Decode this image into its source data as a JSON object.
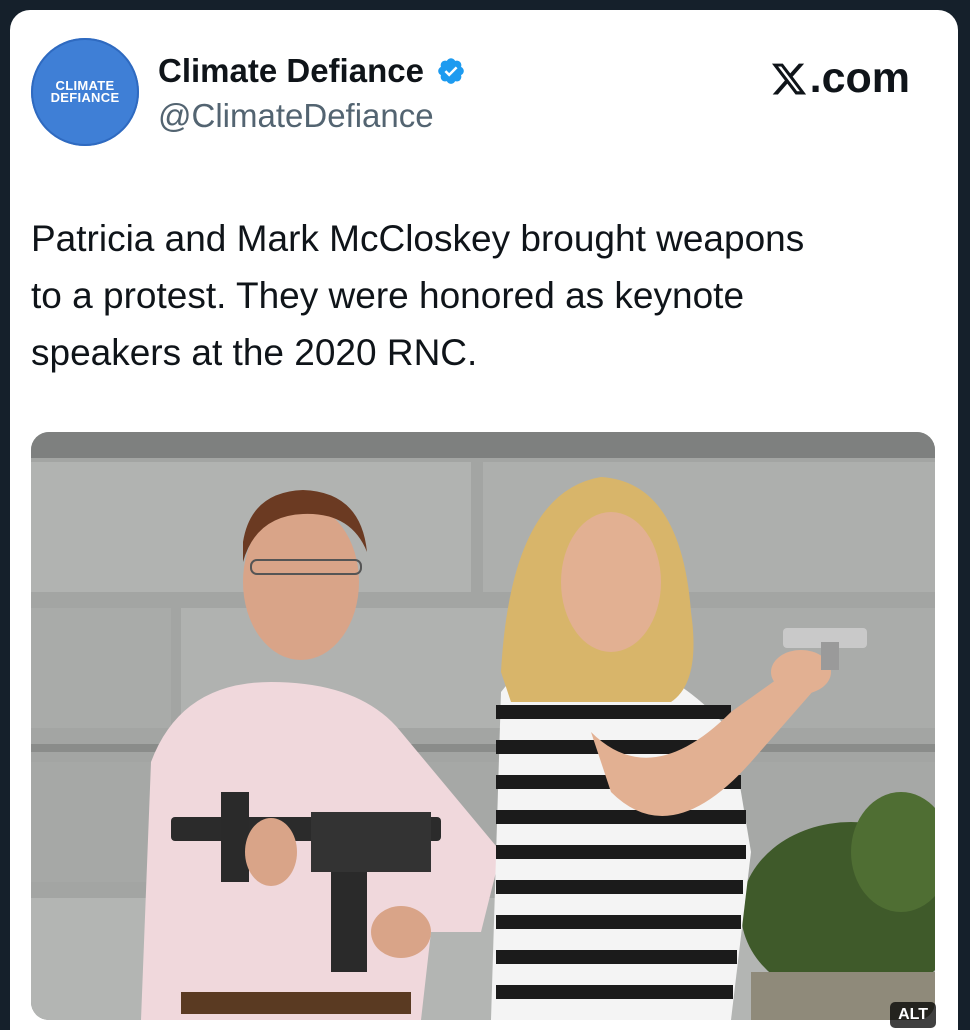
{
  "tweet": {
    "avatar": {
      "line1": "CLIMATE",
      "line2": "DEFIANCE"
    },
    "display_name": "Climate Defiance",
    "handle": "@ClimateDefiance",
    "site": ".com",
    "lines": [
      "Patricia and Mark McCloskey brought weapons",
      "to a protest. They were honored as keynote",
      "speakers at the 2020 RNC."
    ]
  },
  "media": {
    "alt_badge": "ALT"
  },
  "colors": {
    "brand_blue": "#1d9bf0",
    "avatar_blue": "#3f7fd6",
    "text": "#0f1419",
    "muted": "#536471"
  },
  "icons": {
    "verified": "verified-badge-icon",
    "x": "x-logo-icon"
  }
}
